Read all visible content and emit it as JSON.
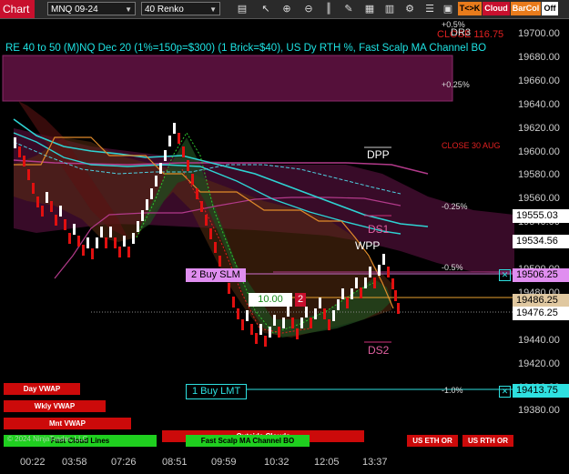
{
  "toolbar": {
    "chart_label": "Chart",
    "instrument": "MNQ 09-24",
    "bar_type": "40 Renko",
    "icons": [
      "folder-icon",
      "pointer-icon",
      "magnifier-plus-icon",
      "magnifier-minus-icon",
      "bars-icon",
      "pencil-icon",
      "layers-icon",
      "grid-icon",
      "settings-icon",
      "list-icon",
      "template-icon"
    ],
    "tck_label": "T<>K",
    "cloud_label": "Cloud",
    "barcol_label": "BarCol",
    "off_label": "Off"
  },
  "title": "RE 40 to 50 (M)NQ Dec 20 (1%=150p=$300) (1 Brick=$40), US Dy RTH %, Fast Scalp MA Channel BO",
  "overlay_labels": {
    "top_pct": "+0.5%",
    "close_red": "CLOSE 116.75",
    "dr3": "DR3",
    "plus025": "+0.25%",
    "close_aug": "CLOSE 30 AUG",
    "dpp": "DPP",
    "minus025": "-0.25%",
    "ds1": "DS1",
    "wpp": "WPP",
    "minus05": "-0.5%",
    "ds2": "DS2",
    "minus10": "-1.0%"
  },
  "orders": {
    "buy_slm": "2 Buy SLM",
    "qty_price": "10.00",
    "qty_count": "2",
    "buy_lmt": "1 Buy LMT"
  },
  "yaxis_ticks": [
    "19700.00",
    "19680.00",
    "19660.00",
    "19640.00",
    "19620.00",
    "19600.00",
    "19580.00",
    "19560.00",
    "19540.00",
    "19520.00",
    "19500.00",
    "19480.00",
    "19460.00",
    "19440.00",
    "19420.00",
    "19400.00",
    "19380.00"
  ],
  "price_boxes": {
    "p1": "19555.03",
    "p2": "19534.56",
    "p3": "19506.25",
    "p4": "19486.25",
    "p5": "19476.25",
    "p6": "19413.75"
  },
  "xaxis_ticks": [
    "00:22",
    "03:58",
    "07:26",
    "08:51",
    "09:59",
    "10:32",
    "12:05",
    "13:37"
  ],
  "bottom_buttons": {
    "day_vwap": "Day VWAP",
    "wkly_vwap": "Wkly VWAP",
    "mnt_vwap": "Mnt VWAP",
    "fast_cloud": "Fast Cloud Lines",
    "fast_scalp": "Fast Scalp MA Channel BO",
    "outside_clouds": "Outside Clouds",
    "us_eth_or": "US ETH OR",
    "us_rth_or": "US RTH OR"
  },
  "watermark": "© 2024 NinjaTrader, LLC",
  "colors": {
    "accent_red": "#c8102e",
    "cyan": "#1ee3e3",
    "magenta_box": "#5a0f3c",
    "bull": "#ffffff",
    "bear": "#e01010"
  }
}
